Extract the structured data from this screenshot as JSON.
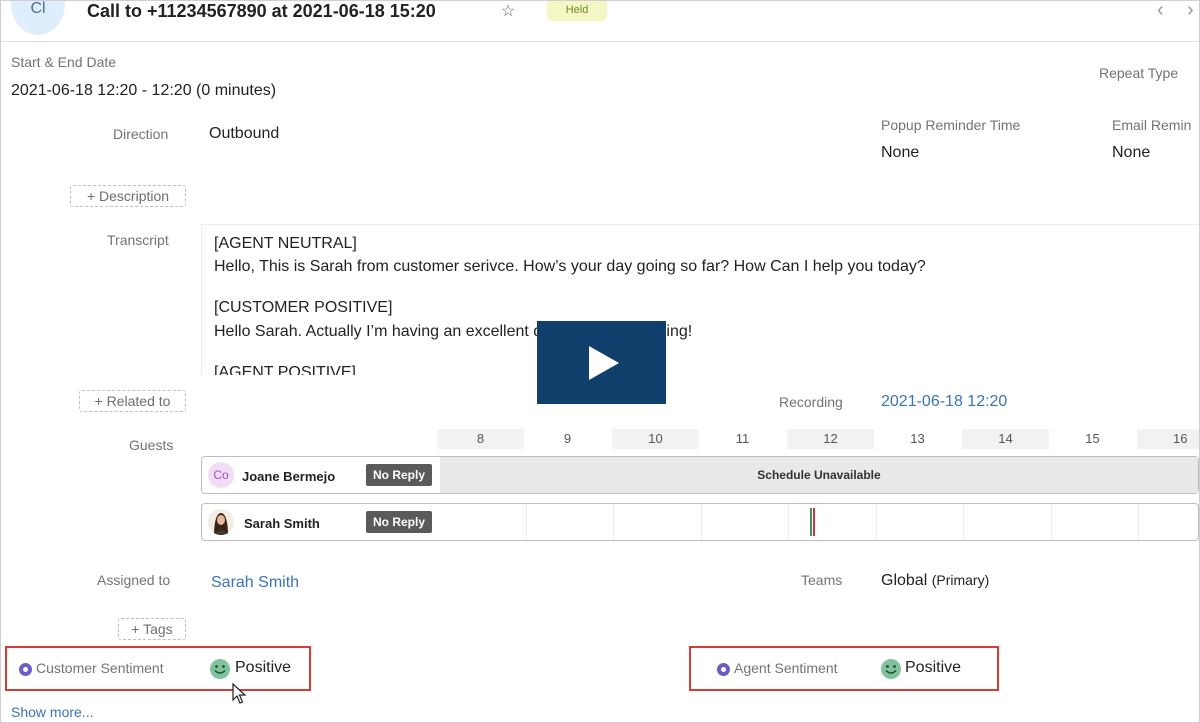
{
  "header": {
    "avatar_initials": "Cl",
    "title": "Call to +11234567890 at 2021-06-18 15:20",
    "status_badge": "Held",
    "prev_glyph": "‹",
    "next_glyph": "›"
  },
  "fields": {
    "start_end_label": "Start & End Date",
    "start_end_value": "2021-06-18 12:20 - 12:20 (0 minutes)",
    "repeat_type_label": "Repeat Type",
    "direction_label": "Direction",
    "direction_value": "Outbound",
    "popup_reminder_label": "Popup Reminder Time",
    "popup_reminder_value": "None",
    "email_reminder_label": "Email Remin",
    "email_reminder_value": "None",
    "description_button": "+ Description",
    "transcript_label": "Transcript",
    "related_button": "+ Related to",
    "recording_label": "Recording",
    "recording_value": "2021-06-18 12:20",
    "guests_label": "Guests",
    "assigned_label": "Assigned to",
    "assigned_value": "Sarah Smith",
    "teams_label": "Teams",
    "teams_value": "Global",
    "teams_suffix": "(Primary)",
    "tags_button": "+ Tags",
    "show_more": "Show more..."
  },
  "transcript": [
    "[AGENT NEUTRAL]",
    "Hello, This is Sarah from customer serivce.  How’s your day going so far?  How Can I help you today?",
    "[CUSTOMER POSITIVE]",
    "Hello Sarah.  Actually I’m having an excellent day, thanks for asking!",
    "[AGENT POSITIVE]"
  ],
  "timeline_hours": [
    "8",
    "9",
    "10",
    "11",
    "12",
    "13",
    "14",
    "15",
    "16"
  ],
  "guests": [
    {
      "initials": "Co",
      "name": "Joane Bermejo",
      "status": "No Reply",
      "schedule": "Schedule Unavailable"
    },
    {
      "name": "Sarah Smith",
      "status": "No Reply"
    }
  ],
  "sentiment": {
    "customer_label": "Customer Sentiment",
    "customer_value": "Positive",
    "agent_label": "Agent Sentiment",
    "agent_value": "Positive"
  },
  "colors": {
    "accent_link": "#3b73b9",
    "play_button": "#113f6b",
    "highlight_border": "#d23b36",
    "sentiment_dot": "#6d5cc7",
    "smile_face": "#7fc29b"
  }
}
